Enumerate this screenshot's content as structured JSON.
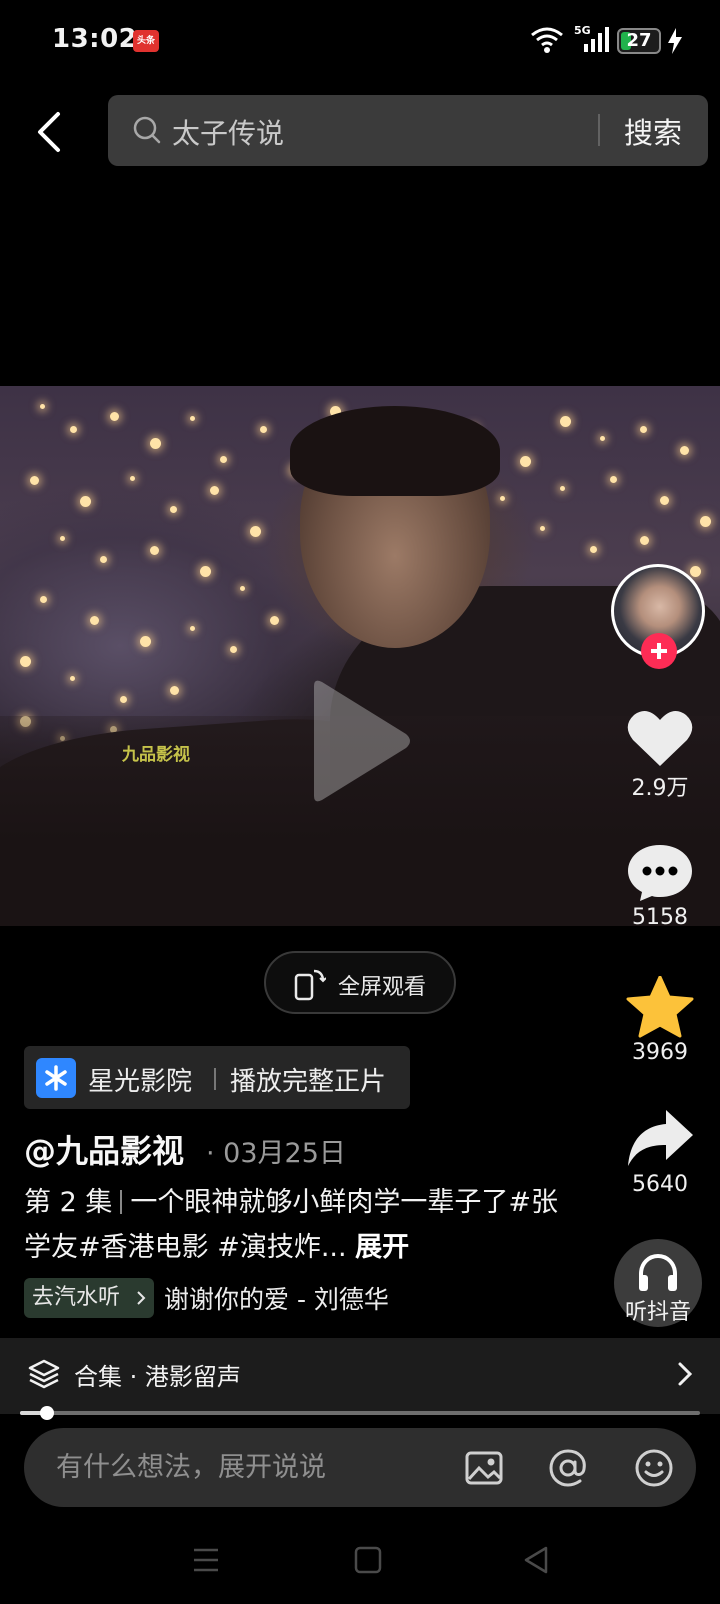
{
  "status_bar": {
    "time": "13:02",
    "app_badge": "头条",
    "network": "5G",
    "battery": "27",
    "battery_level": 0.27
  },
  "search": {
    "query": "太子传说",
    "button_label": "搜索"
  },
  "video": {
    "watermark": "九品影视",
    "fullscreen_label": "全屏观看",
    "progress": 0.04
  },
  "actions": {
    "likes": "2.9万",
    "comments": "5158",
    "favorites": "3969",
    "shares": "5640",
    "listen_label": "听抖音"
  },
  "promo": {
    "name": "星光影院",
    "action": "播放完整正片"
  },
  "post": {
    "author": "@九品影视",
    "date": "· 03月25日",
    "episode": "第 2 集",
    "caption": "一个眼神就够小鲜肉学一辈子了#张学友#香港电影 #演技炸...",
    "expand": "展开"
  },
  "music": {
    "tag": "去汽水听",
    "title": "谢谢你的爱 - 刘德华"
  },
  "collection": {
    "label": "合集 · 港影留声"
  },
  "comment": {
    "placeholder": "有什么想法，展开说说"
  },
  "colors": {
    "accent_red": "#fe2c55",
    "star_yellow": "#fcc23a",
    "promo_blue": "#2f87ff",
    "battery_green": "#21b24c"
  },
  "icons": [
    "back-icon",
    "search-icon",
    "play-icon",
    "heart-icon",
    "comment-icon",
    "star-icon",
    "share-icon",
    "headphones-icon",
    "fullscreen-icon",
    "layers-icon",
    "chevron-right-icon",
    "image-icon",
    "at-icon",
    "emoji-icon"
  ]
}
